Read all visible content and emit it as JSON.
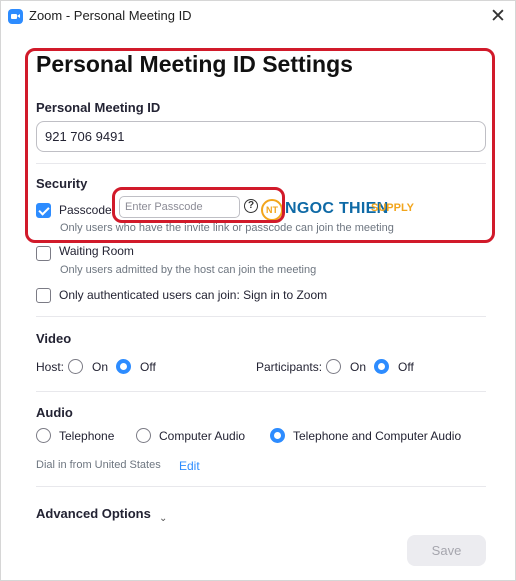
{
  "window": {
    "title": "Zoom - Personal Meeting ID",
    "close_glyph": "✕"
  },
  "page_title": "Personal Meeting ID Settings",
  "meeting_id": {
    "label": "Personal Meeting ID",
    "value": "921 706 9491"
  },
  "security": {
    "label": "Security",
    "passcode": {
      "label": "Passcode",
      "checked": true,
      "placeholder": "Enter Passcode",
      "help_glyph": "?",
      "description": "Only users who have the invite link or passcode can join the meeting"
    },
    "waiting_room": {
      "label": "Waiting Room",
      "checked": false,
      "description": "Only users admitted by the host can join the meeting"
    },
    "authenticated": {
      "label": "Only authenticated users can join: Sign in to Zoom",
      "checked": false
    }
  },
  "video": {
    "label": "Video",
    "host": {
      "label": "Host:",
      "on": "On",
      "off": "Off",
      "selected": "Off"
    },
    "participants": {
      "label": "Participants:",
      "on": "On",
      "off": "Off",
      "selected": "Off"
    }
  },
  "audio": {
    "label": "Audio",
    "options": [
      "Telephone",
      "Computer Audio",
      "Telephone and Computer Audio"
    ],
    "selected": "Telephone and Computer Audio",
    "dial_in_text": "Dial in from United States",
    "edit_label": "Edit"
  },
  "advanced": {
    "label": "Advanced Options",
    "chevron": "⌄"
  },
  "save_label": "Save",
  "watermark": {
    "badge": "NT",
    "name": "NGOC THIEN",
    "supply": "SUPPLY"
  },
  "colors": {
    "accent": "#2d8cff",
    "highlight": "#d11a2a"
  }
}
